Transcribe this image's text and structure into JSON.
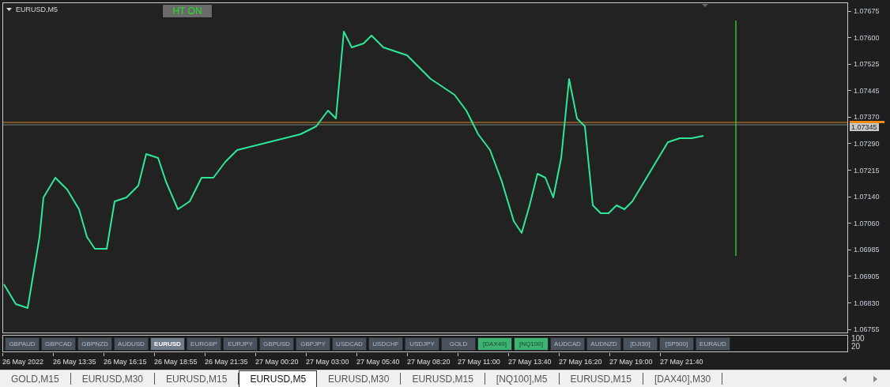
{
  "chart": {
    "title": "EURUSD,M5",
    "ht_button": "HT ON",
    "bid_tag": "1.07345",
    "price_labels": [
      "1.07675",
      "1.07600",
      "1.07525",
      "1.07445",
      "1.07370",
      "1.07290",
      "1.07215",
      "1.07140",
      "1.07060",
      "1.06985",
      "1.06905",
      "1.06830",
      "1.06755"
    ],
    "time_labels": [
      "26 May 2022",
      "26 May 13:35",
      "26 May 16:15",
      "26 May 18:55",
      "26 May 21:35",
      "27 May 00:20",
      "27 May 03:00",
      "27 May 05:40",
      "27 May 08:20",
      "27 May 11:00",
      "27 May 13:40",
      "27 May 16:20",
      "27 May 19:00",
      "27 May 21:40"
    ]
  },
  "symbol_buttons": [
    {
      "label": "GBPAUD",
      "selected": false,
      "highlighted": false
    },
    {
      "label": "GBPCAD",
      "selected": false,
      "highlighted": false
    },
    {
      "label": "GBPNZD",
      "selected": false,
      "highlighted": false
    },
    {
      "label": "AUDUSD",
      "selected": false,
      "highlighted": false
    },
    {
      "label": "EURUSD",
      "selected": true,
      "highlighted": false
    },
    {
      "label": "EURGBP",
      "selected": false,
      "highlighted": false
    },
    {
      "label": "EURJPY",
      "selected": false,
      "highlighted": false
    },
    {
      "label": "GBPUSD",
      "selected": false,
      "highlighted": false
    },
    {
      "label": "GBPJPY",
      "selected": false,
      "highlighted": false
    },
    {
      "label": "USDCAD",
      "selected": false,
      "highlighted": false
    },
    {
      "label": "USDCHF",
      "selected": false,
      "highlighted": false
    },
    {
      "label": "USDJPY",
      "selected": false,
      "highlighted": false
    },
    {
      "label": "GOLD",
      "selected": false,
      "highlighted": false
    },
    {
      "label": "[DAX40]",
      "selected": false,
      "highlighted": true
    },
    {
      "label": "[NQ100]",
      "selected": false,
      "highlighted": true
    },
    {
      "label": "AUDCAD",
      "selected": false,
      "highlighted": false
    },
    {
      "label": "AUDNZD",
      "selected": false,
      "highlighted": false
    },
    {
      "label": "[DJI30]",
      "selected": false,
      "highlighted": false
    },
    {
      "label": "[SP500]",
      "selected": false,
      "highlighted": false
    },
    {
      "label": "EURAUD",
      "selected": false,
      "highlighted": false
    }
  ],
  "indicator_scale": [
    "100",
    "20"
  ],
  "tabs": [
    {
      "label": "GOLD,M15",
      "selected": false
    },
    {
      "label": "EURUSD,M30",
      "selected": false
    },
    {
      "label": "EURUSD,M15",
      "selected": false
    },
    {
      "label": "EURUSD,M5",
      "selected": true
    },
    {
      "label": "EURUSD,M30",
      "selected": false
    },
    {
      "label": "EURUSD,M15",
      "selected": false
    },
    {
      "label": "[NQ100],M5",
      "selected": false
    },
    {
      "label": "EURUSD,M15",
      "selected": false
    },
    {
      "label": "[DAX40],M30",
      "selected": false
    }
  ]
}
